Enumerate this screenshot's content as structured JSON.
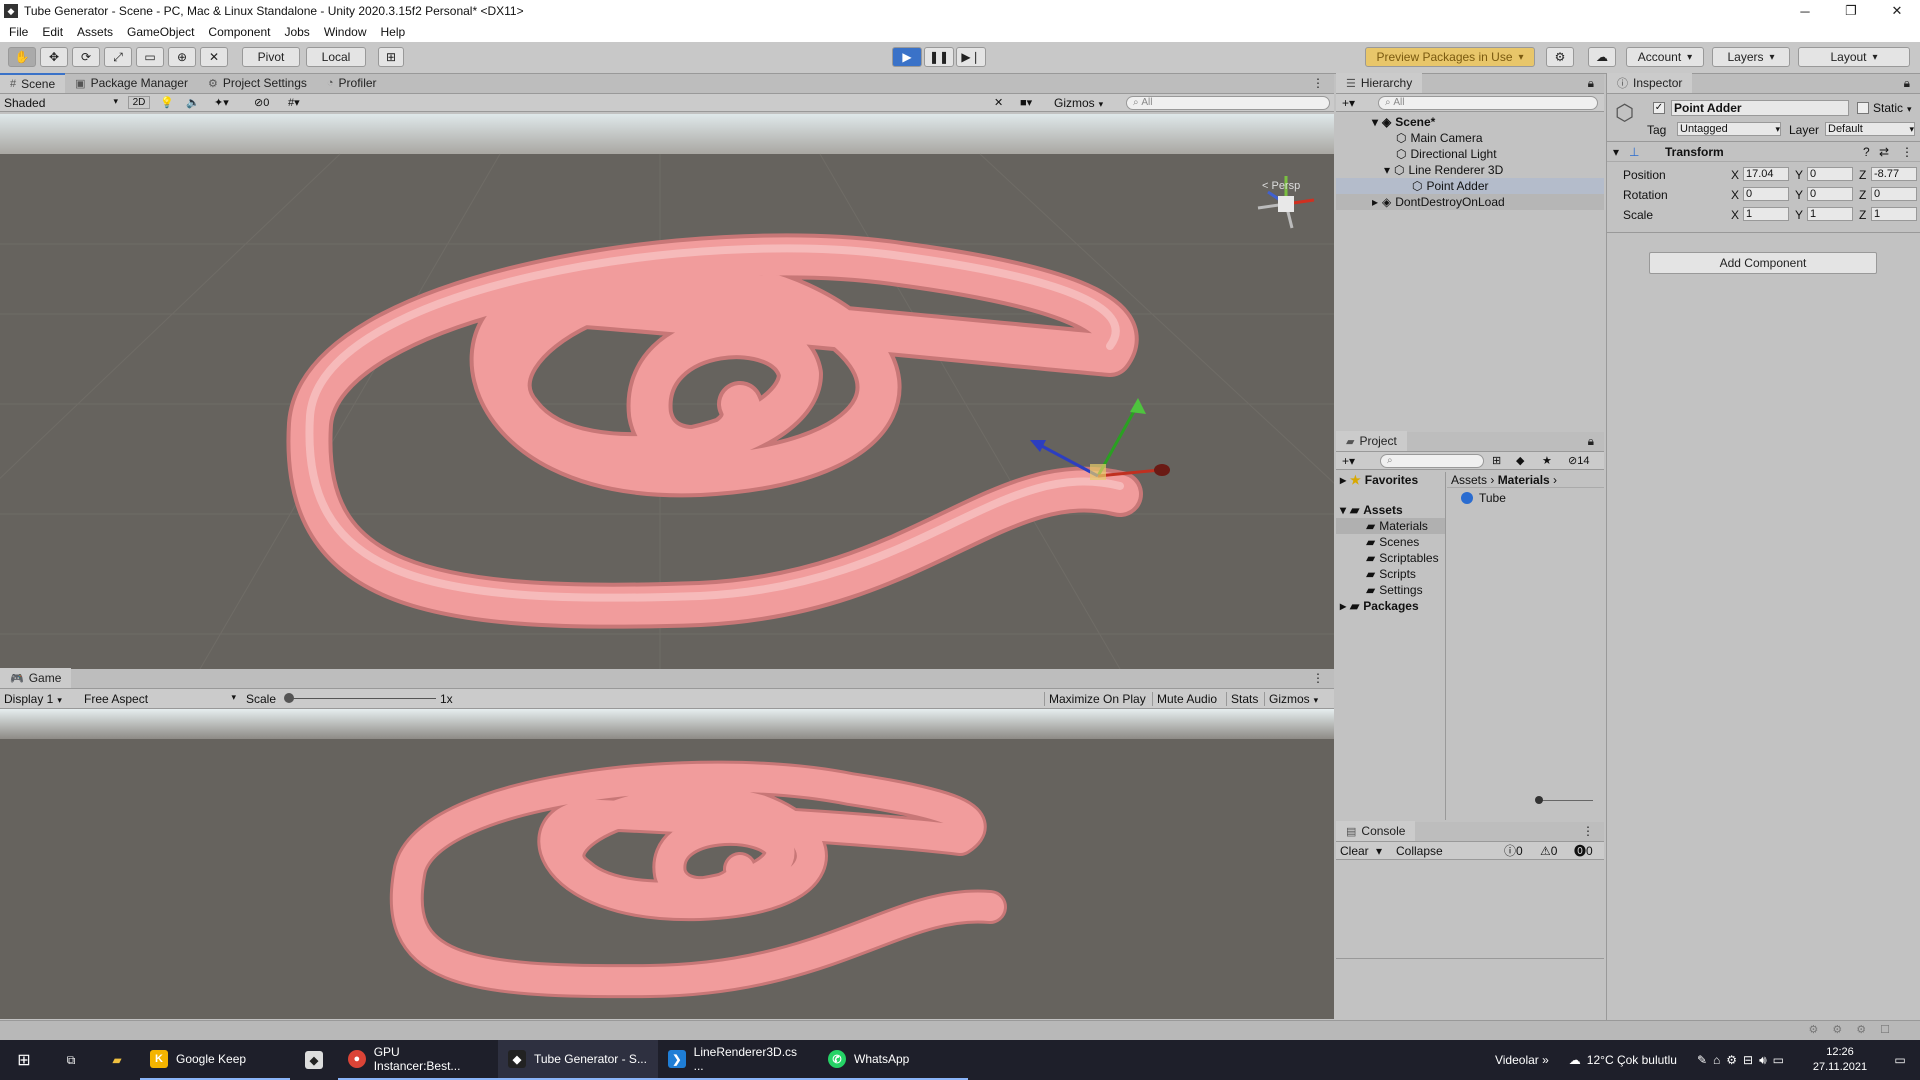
{
  "window": {
    "title": "Tube Generator - Scene - PC, Mac & Linux Standalone - Unity 2020.3.15f2 Personal* <DX11>",
    "app_icon": "unity-icon"
  },
  "menu": [
    "File",
    "Edit",
    "Assets",
    "GameObject",
    "Component",
    "Jobs",
    "Window",
    "Help"
  ],
  "toolbar": {
    "pivot": "Pivot",
    "local": "Local",
    "preview_packages": "Preview Packages in Use",
    "account": "Account",
    "layers": "Layers",
    "layout": "Layout"
  },
  "scene": {
    "tabs": [
      "Scene",
      "Package Manager",
      "Project Settings",
      "Profiler"
    ],
    "shading": "Shaded",
    "mode_2d": "2D",
    "hidden_count": "0",
    "gizmos": "Gizmos",
    "search_placeholder": "All",
    "persp": "< Persp"
  },
  "game": {
    "tab": "Game",
    "display": "Display 1",
    "aspect": "Free Aspect",
    "scale_label": "Scale",
    "scale_value": "1x",
    "maximize": "Maximize On Play",
    "mute": "Mute Audio",
    "stats": "Stats",
    "gizmos": "Gizmos"
  },
  "hierarchy": {
    "title": "Hierarchy",
    "search_placeholder": "All",
    "items": [
      "Scene*",
      "Main Camera",
      "Directional Light",
      "Line Renderer 3D",
      "Point Adder",
      "DontDestroyOnLoad"
    ]
  },
  "project": {
    "title": "Project",
    "count": "14",
    "favorites": "Favorites",
    "assets": "Assets",
    "folders": [
      "Materials",
      "Scenes",
      "Scriptables",
      "Scripts",
      "Settings"
    ],
    "packages": "Packages",
    "breadcrumb": [
      "Assets",
      "Materials"
    ],
    "items": [
      "Tube"
    ]
  },
  "console": {
    "title": "Console",
    "clear": "Clear",
    "collapse": "Collapse",
    "logs": "0",
    "warnings": "0",
    "errors": "0"
  },
  "inspector": {
    "title": "Inspector",
    "object_name": "Point Adder",
    "static": "Static",
    "tag_label": "Tag",
    "tag": "Untagged",
    "layer_label": "Layer",
    "layer": "Default",
    "component": "Transform",
    "add_component": "Add Component",
    "rows": [
      {
        "label": "Position",
        "x": "17.04",
        "y": "0",
        "z": "-8.77"
      },
      {
        "label": "Rotation",
        "x": "0",
        "y": "0",
        "z": "0"
      },
      {
        "label": "Scale",
        "x": "1",
        "y": "1",
        "z": "1"
      }
    ],
    "axes": {
      "x": "X",
      "y": "Y",
      "z": "Z"
    }
  },
  "taskbar": {
    "apps": [
      "Google Keep",
      "",
      "GPU Instancer:Best...",
      "Tube Generator - S...",
      "LineRenderer3D.cs ...",
      "WhatsApp"
    ],
    "videolar": "Videolar",
    "weather": "12°C  Çok bulutlu",
    "time": "12:26",
    "date": "27.11.2021"
  },
  "colors": {
    "tube": "#f19c9c",
    "ground": "#66635e",
    "sky": "#dfe8ea",
    "accent": "#3a72c8"
  }
}
